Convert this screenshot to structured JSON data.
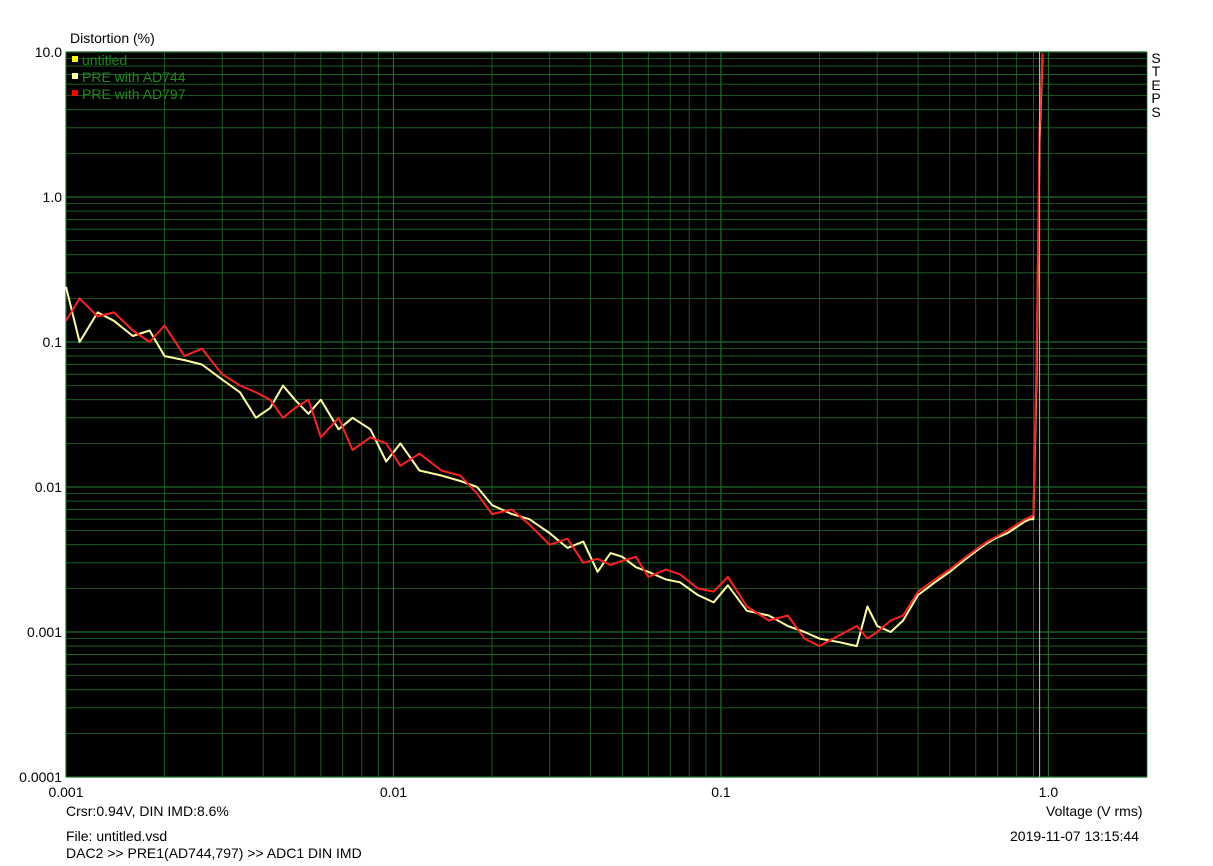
{
  "chart_data": {
    "type": "line",
    "ylabel": "Distortion (%)",
    "xlabel": "Voltage (V rms)",
    "x_scale": "log",
    "y_scale": "log",
    "xlim": [
      0.001,
      2.0
    ],
    "ylim": [
      0.0001,
      10.0
    ],
    "grid": true,
    "background": "#000000",
    "grid_color": "#1f6b2a",
    "x_ticks": [
      "0.001",
      "0.01",
      "0.1",
      "1.0"
    ],
    "y_ticks": [
      "10.0",
      "1.0",
      "0.1",
      "0.01",
      "0.001",
      "0.0001"
    ],
    "cursor_x": 0.94,
    "legend_position": "top-left",
    "legend": [
      {
        "name": "untitled",
        "color": "#ffff00"
      },
      {
        "name": "PRE with AD744",
        "color": "#ffff99"
      },
      {
        "name": "PRE with AD797",
        "color": "#ff0000"
      }
    ],
    "series": [
      {
        "name": "PRE with AD744",
        "color": "#ffffa0",
        "x": [
          0.001,
          0.0011,
          0.00125,
          0.0014,
          0.0016,
          0.0018,
          0.002,
          0.0023,
          0.0026,
          0.003,
          0.0034,
          0.0038,
          0.0042,
          0.0046,
          0.005,
          0.0055,
          0.006,
          0.0068,
          0.0075,
          0.0085,
          0.0095,
          0.0105,
          0.012,
          0.014,
          0.016,
          0.018,
          0.02,
          0.023,
          0.026,
          0.03,
          0.034,
          0.038,
          0.042,
          0.046,
          0.05,
          0.055,
          0.06,
          0.068,
          0.075,
          0.085,
          0.095,
          0.105,
          0.12,
          0.14,
          0.16,
          0.18,
          0.2,
          0.23,
          0.26,
          0.28,
          0.3,
          0.33,
          0.36,
          0.4,
          0.45,
          0.5,
          0.55,
          0.6,
          0.65,
          0.7,
          0.75,
          0.8,
          0.85,
          0.88,
          0.9,
          0.92,
          0.94,
          0.96
        ],
        "values": [
          0.24,
          0.1,
          0.16,
          0.14,
          0.11,
          0.12,
          0.08,
          0.075,
          0.07,
          0.055,
          0.045,
          0.03,
          0.035,
          0.05,
          0.04,
          0.032,
          0.04,
          0.025,
          0.03,
          0.025,
          0.015,
          0.02,
          0.013,
          0.012,
          0.011,
          0.01,
          0.0075,
          0.0065,
          0.006,
          0.0048,
          0.0038,
          0.0042,
          0.0026,
          0.0035,
          0.0033,
          0.0028,
          0.0026,
          0.0023,
          0.0022,
          0.0018,
          0.0016,
          0.0021,
          0.0014,
          0.0013,
          0.0011,
          0.001,
          0.0009,
          0.00085,
          0.0008,
          0.0015,
          0.0011,
          0.001,
          0.0012,
          0.0018,
          0.0022,
          0.0026,
          0.0031,
          0.0036,
          0.0041,
          0.0045,
          0.0048,
          0.0053,
          0.0058,
          0.006,
          0.006,
          0.06,
          2.5,
          9.5
        ]
      },
      {
        "name": "PRE with AD797",
        "color": "#ff2020",
        "x": [
          0.001,
          0.0011,
          0.00125,
          0.0014,
          0.0016,
          0.0018,
          0.002,
          0.0023,
          0.0026,
          0.003,
          0.0034,
          0.0038,
          0.0042,
          0.0046,
          0.005,
          0.0055,
          0.006,
          0.0068,
          0.0075,
          0.0085,
          0.0095,
          0.0105,
          0.012,
          0.014,
          0.016,
          0.018,
          0.02,
          0.023,
          0.026,
          0.03,
          0.034,
          0.038,
          0.042,
          0.046,
          0.05,
          0.055,
          0.06,
          0.068,
          0.075,
          0.085,
          0.095,
          0.105,
          0.12,
          0.14,
          0.16,
          0.18,
          0.2,
          0.23,
          0.26,
          0.28,
          0.3,
          0.33,
          0.36,
          0.4,
          0.45,
          0.5,
          0.55,
          0.6,
          0.65,
          0.7,
          0.75,
          0.8,
          0.85,
          0.88,
          0.9,
          0.92,
          0.94,
          0.96
        ],
        "values": [
          0.14,
          0.2,
          0.15,
          0.16,
          0.12,
          0.1,
          0.13,
          0.08,
          0.09,
          0.06,
          0.05,
          0.045,
          0.04,
          0.03,
          0.035,
          0.04,
          0.022,
          0.03,
          0.018,
          0.022,
          0.02,
          0.014,
          0.017,
          0.013,
          0.012,
          0.009,
          0.0065,
          0.007,
          0.0055,
          0.004,
          0.0044,
          0.003,
          0.0032,
          0.0029,
          0.0031,
          0.0033,
          0.0024,
          0.0027,
          0.0025,
          0.002,
          0.0019,
          0.0024,
          0.0015,
          0.0012,
          0.0013,
          0.0009,
          0.0008,
          0.00095,
          0.0011,
          0.0009,
          0.001,
          0.0012,
          0.0013,
          0.0019,
          0.0023,
          0.0027,
          0.0032,
          0.0037,
          0.0042,
          0.0046,
          0.005,
          0.0055,
          0.006,
          0.0062,
          0.0064,
          0.08,
          3.0,
          9.8
        ]
      }
    ]
  },
  "side_label": "STEPS",
  "footer": {
    "cursor_readout": "Crsr:0.94V, DIN IMD:8.6%",
    "file": "File: untitled.vsd",
    "path": "DAC2 >> PRE1(AD744,797) >> ADC1 DIN IMD",
    "timestamp": "2019-11-07  13:15:44"
  }
}
